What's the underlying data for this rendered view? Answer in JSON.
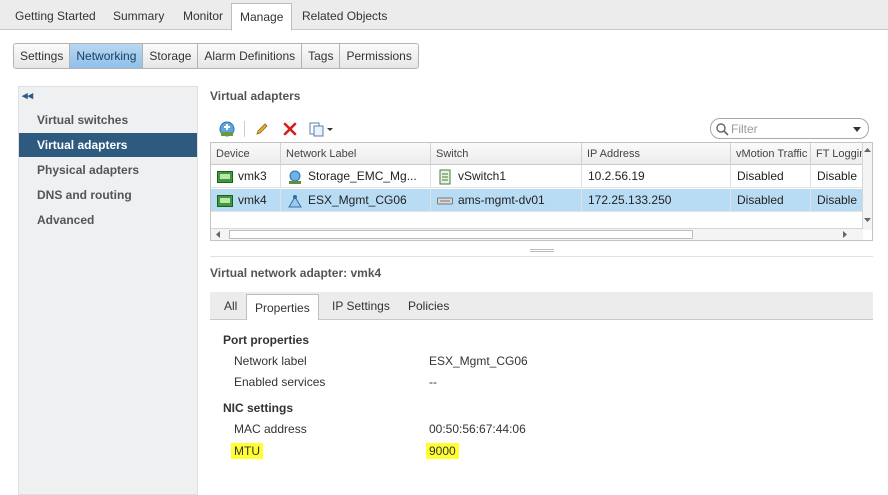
{
  "top_tabs": [
    {
      "label": "Getting Started"
    },
    {
      "label": "Summary"
    },
    {
      "label": "Monitor"
    },
    {
      "label": "Manage",
      "active": true
    },
    {
      "label": "Related Objects"
    }
  ],
  "sub_tabs": [
    {
      "label": "Settings"
    },
    {
      "label": "Networking",
      "active": true
    },
    {
      "label": "Storage"
    },
    {
      "label": "Alarm Definitions"
    },
    {
      "label": "Tags"
    },
    {
      "label": "Permissions"
    }
  ],
  "left_nav": {
    "collapse_glyph": "◂◂",
    "items": [
      {
        "label": "Virtual switches"
      },
      {
        "label": "Virtual adapters",
        "active": true
      },
      {
        "label": "Physical adapters"
      },
      {
        "label": "DNS and routing"
      },
      {
        "label": "Advanced"
      }
    ]
  },
  "main": {
    "title": "Virtual adapters",
    "filter_placeholder": "Filter",
    "columns": [
      "Device",
      "Network Label",
      "Switch",
      "IP Address",
      "vMotion Traffic",
      "FT Logging"
    ],
    "rows": [
      {
        "device": "vmk3",
        "network_label": "Storage_EMC_Mg...",
        "switch": "vSwitch1",
        "ip": "10.2.56.19",
        "vmotion": "Disabled",
        "ft": "Disable",
        "selected": false
      },
      {
        "device": "vmk4",
        "network_label": "ESX_Mgmt_CG06",
        "switch": "ams-mgmt-dv01",
        "ip": "172.25.133.250",
        "vmotion": "Disabled",
        "ft": "Disable",
        "selected": true
      }
    ]
  },
  "detail": {
    "title": "Virtual network adapter: vmk4",
    "tabs": [
      {
        "label": "All"
      },
      {
        "label": "Properties",
        "active": true
      },
      {
        "label": "IP Settings"
      },
      {
        "label": "Policies"
      }
    ],
    "port_properties": {
      "heading": "Port properties",
      "network_label_key": "Network label",
      "network_label_value": "ESX_Mgmt_CG06",
      "enabled_services_key": "Enabled services",
      "enabled_services_value": "--"
    },
    "nic_settings": {
      "heading": "NIC settings",
      "mac_key": "MAC address",
      "mac_value": "00:50:56:67:44:06",
      "mtu_key": "MTU",
      "mtu_value": "9000"
    }
  },
  "colors": {
    "selected_row": "#b9dcf5",
    "nav_active": "#2f5a80",
    "highlight": "#ffff33"
  }
}
